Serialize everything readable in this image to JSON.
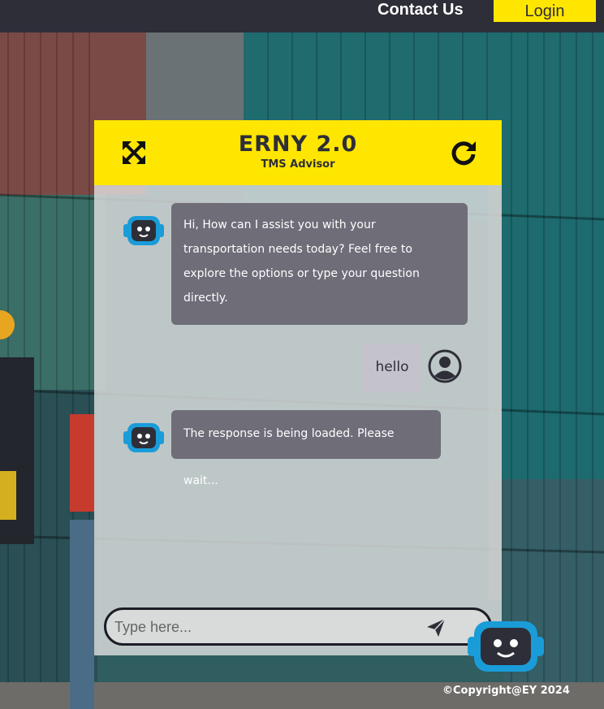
{
  "nav": {
    "contact_label": "Contact Us",
    "login_label": "Login"
  },
  "chat": {
    "title": "ERNY 2.0",
    "subtitle": "TMS Advisor",
    "messages": [
      {
        "from": "bot",
        "text": "Hi, How can I assist you with your transportation needs today? Feel free to explore the options or type your question directly."
      },
      {
        "from": "user",
        "text": "hello"
      },
      {
        "from": "bot",
        "text": "The response is being loaded. Please wait..."
      }
    ],
    "input_placeholder": "Type here..."
  },
  "footer": {
    "copyright": "©Copyright@EY 2024"
  },
  "colors": {
    "brand_yellow": "#ffe600",
    "dark": "#2e2e38",
    "bot_bubble": "#6e6d78",
    "user_bubble": "#c4c3cb",
    "bot_blue": "#1a9cd8"
  },
  "icons": [
    "expand-icon",
    "refresh-icon",
    "bot-avatar-icon",
    "user-avatar-icon",
    "send-icon",
    "chatbot-launcher-icon"
  ]
}
